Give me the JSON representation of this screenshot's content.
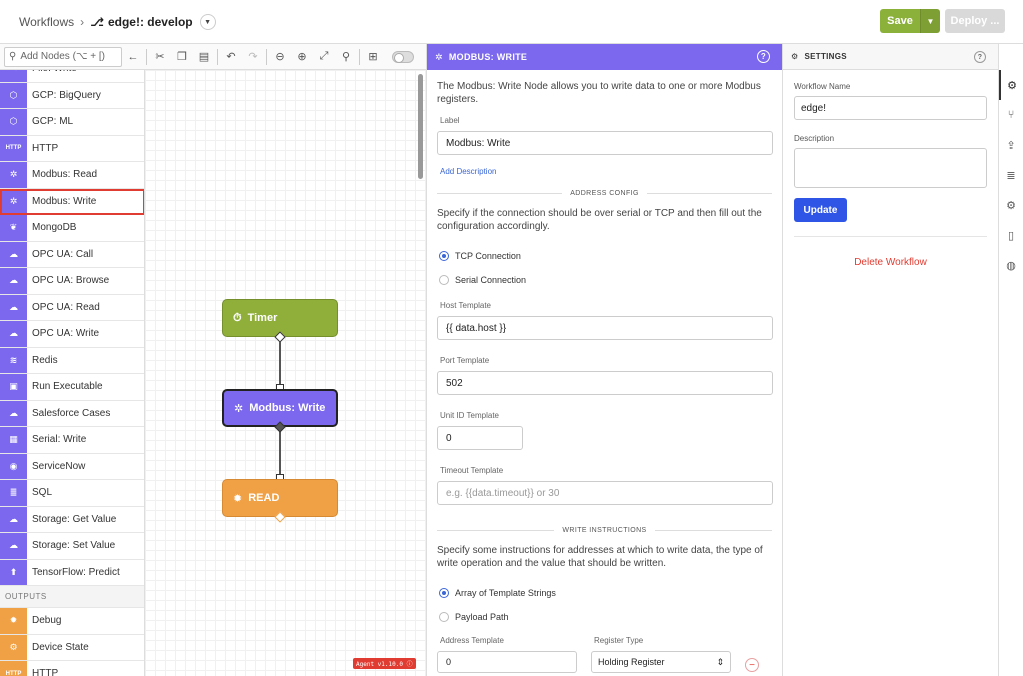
{
  "header": {
    "breadcrumb_root": "Workflows",
    "breadcrumb_sep": "›",
    "branch": "edge!: develop",
    "save_label": "Save",
    "deploy_label": "Deploy ..."
  },
  "toolbar": {
    "add_nodes_placeholder": "Add Nodes (⌥ + [)"
  },
  "palette": {
    "items_top": [
      {
        "label": "File: Write",
        "icon": "file-write-icon",
        "glyph": "✎"
      },
      {
        "label": "GCP: BigQuery",
        "icon": "gcp-icon",
        "glyph": "⬡"
      },
      {
        "label": "GCP: ML",
        "icon": "gcp-icon",
        "glyph": "⬡"
      },
      {
        "label": "HTTP",
        "icon": "http-icon",
        "glyph": "HTTP"
      },
      {
        "label": "Modbus: Read",
        "icon": "modbus-icon",
        "glyph": "✲"
      },
      {
        "label": "Modbus: Write",
        "icon": "modbus-icon",
        "glyph": "✲"
      },
      {
        "label": "MongoDB",
        "icon": "mongodb-icon",
        "glyph": "❦"
      },
      {
        "label": "OPC UA: Call",
        "icon": "opcua-icon",
        "glyph": "☁"
      },
      {
        "label": "OPC UA: Browse",
        "icon": "opcua-icon",
        "glyph": "☁"
      },
      {
        "label": "OPC UA: Read",
        "icon": "opcua-icon",
        "glyph": "☁"
      },
      {
        "label": "OPC UA: Write",
        "icon": "opcua-icon",
        "glyph": "☁"
      },
      {
        "label": "Redis",
        "icon": "redis-icon",
        "glyph": "≋"
      },
      {
        "label": "Run Executable",
        "icon": "terminal-icon",
        "glyph": "▣"
      },
      {
        "label": "Salesforce Cases",
        "icon": "salesforce-icon",
        "glyph": "☁"
      },
      {
        "label": "Serial: Write",
        "icon": "serial-icon",
        "glyph": "▦"
      },
      {
        "label": "ServiceNow",
        "icon": "servicenow-icon",
        "glyph": "◉"
      },
      {
        "label": "SQL",
        "icon": "database-icon",
        "glyph": "≣"
      },
      {
        "label": "Storage: Get Value",
        "icon": "cloud-storage-icon",
        "glyph": "☁"
      },
      {
        "label": "Storage: Set Value",
        "icon": "cloud-storage-icon",
        "glyph": "☁"
      },
      {
        "label": "TensorFlow: Predict",
        "icon": "tensorflow-icon",
        "glyph": "⬆"
      }
    ],
    "selected_index": 5,
    "section_outputs": "OUTPUTS",
    "items_outputs": [
      {
        "label": "Debug",
        "icon": "debug-icon",
        "glyph": "✹"
      },
      {
        "label": "Device State",
        "icon": "device-state-icon",
        "glyph": "⚙"
      },
      {
        "label": "HTTP",
        "icon": "http-icon",
        "glyph": "HTTP"
      }
    ]
  },
  "canvas": {
    "nodes": {
      "timer": "Timer",
      "modbus": "Modbus: Write",
      "read": "READ"
    },
    "agent_badge": "Agent v1.10.0"
  },
  "node_panel": {
    "title": "MODBUS: WRITE",
    "description": "The Modbus: Write Node allows you to write data to one or more Modbus registers.",
    "label_label": "Label",
    "label_value": "Modbus: Write",
    "add_description": "Add Description",
    "address_config": "ADDRESS CONFIG",
    "address_desc": "Specify if the connection should be over serial or TCP and then fill out the configuration accordingly.",
    "tcp_label": "TCP Connection",
    "serial_label": "Serial Connection",
    "host_label": "Host Template",
    "host_value": "{{ data.host }}",
    "port_label": "Port Template",
    "port_value": "502",
    "unit_label": "Unit ID Template",
    "unit_value": "0",
    "timeout_label": "Timeout Template",
    "timeout_placeholder": "e.g. {{data.timeout}} or 30",
    "write_instructions": "WRITE INSTRUCTIONS",
    "write_desc": "Specify some instructions for addresses at which to write data, the type of write operation and the value that should be written.",
    "array_label": "Array of Template Strings",
    "payload_label": "Payload Path",
    "address_template_label": "Address Template",
    "address_template_value": "0",
    "register_type_label": "Register Type",
    "register_type_value": "Holding Register"
  },
  "settings": {
    "title": "SETTINGS",
    "workflow_name_label": "Workflow Name",
    "workflow_name_value": "edge!",
    "description_label": "Description",
    "update_label": "Update",
    "delete_label": "Delete Workflow"
  },
  "colors": {
    "accent": "#7b68ee",
    "save": "#8cb13a",
    "update": "#2f55e6",
    "danger": "#e03c31"
  }
}
